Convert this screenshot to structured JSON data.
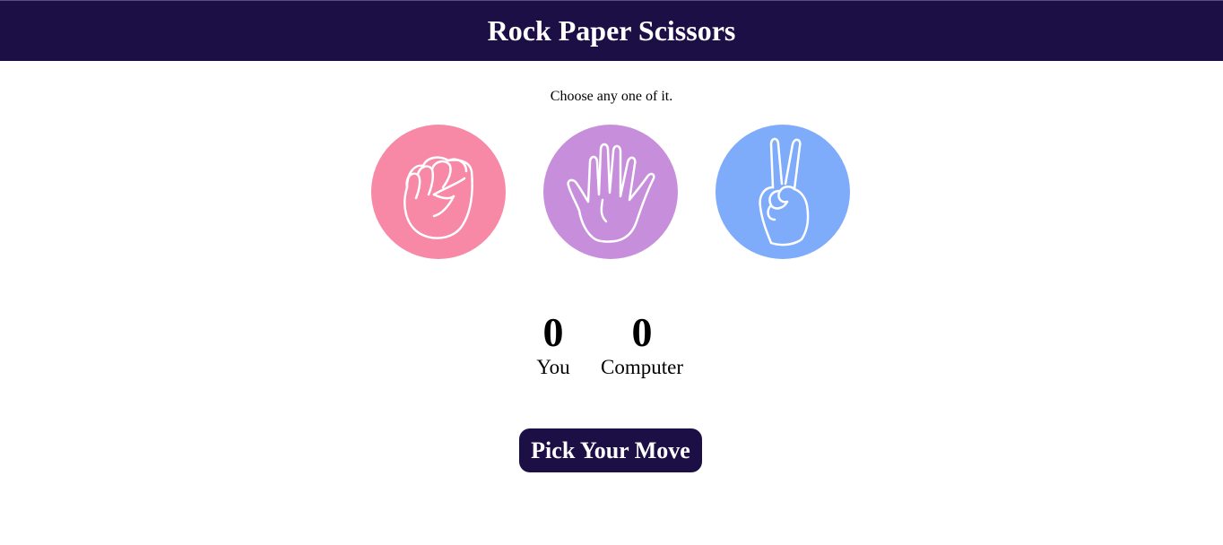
{
  "header": {
    "title": "Rock Paper Scissors"
  },
  "prompt": "Choose any one of it.",
  "choices": [
    {
      "name": "rock",
      "icon": "fist-icon",
      "color": "#f788a6"
    },
    {
      "name": "paper",
      "icon": "open-hand-icon",
      "color": "#c78fdb"
    },
    {
      "name": "scissors",
      "icon": "peace-hand-icon",
      "color": "#7eacfa"
    }
  ],
  "scores": {
    "you": {
      "value": "0",
      "label": "You"
    },
    "computer": {
      "value": "0",
      "label": "Computer"
    }
  },
  "action": {
    "label": "Pick Your Move"
  },
  "colors": {
    "header_bg": "#1c0f45",
    "button_bg": "#1c0f45",
    "text_light": "#ffffff"
  }
}
